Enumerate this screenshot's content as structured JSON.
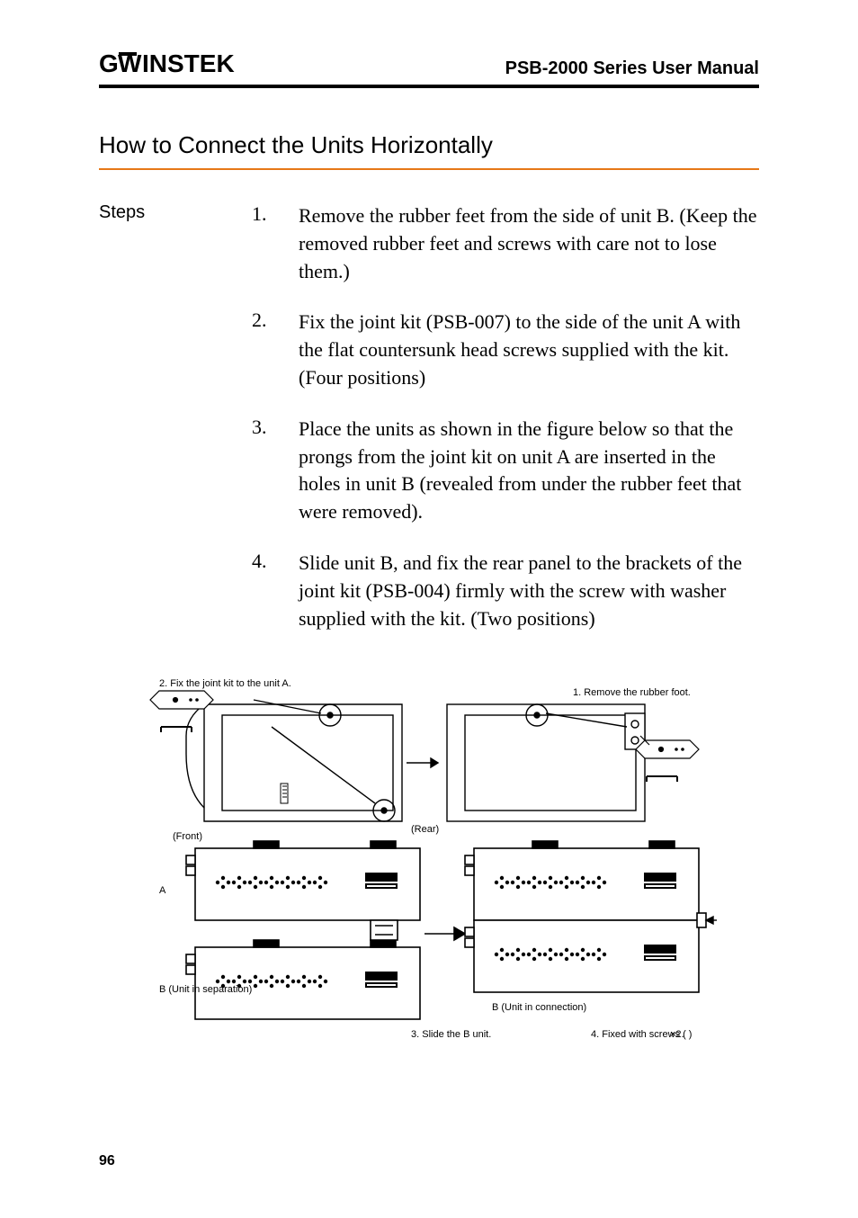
{
  "header": {
    "logo_text": "GW INSTEK",
    "manual_title": "PSB-2000 Series User Manual"
  },
  "section_title": "How to Connect the Units Horizontally",
  "steps_label": "Steps",
  "steps": [
    {
      "num": "1.",
      "text": "Remove the rubber feet from the side of unit B. (Keep the removed rubber feet and screws with care not to lose them.)"
    },
    {
      "num": "2.",
      "text": "Fix the joint kit (PSB-007) to the side of the unit A with the flat countersunk head screws supplied with the kit. (Four positions)"
    },
    {
      "num": "3.",
      "text": "Place the units as shown in the figure below so that the prongs from the joint kit on unit A are inserted in the holes in unit B (revealed from under the rubber feet that were removed)."
    },
    {
      "num": "4.",
      "text": "Slide unit B, and fix the rear panel to the brackets of the joint kit (PSB-004) firmly with the screw with washer supplied with the kit. (Two positions)"
    }
  ],
  "figure_labels": {
    "step1": "1. Remove the rubber foot.",
    "step2": "2. Fix the joint kit to the unit A.",
    "step3": "3. Slide the B unit.",
    "step4": "4. Fixed with screws (    )",
    "unitA": "A",
    "unitB_sep": "B (Unit in separation)",
    "unitB_con": "B (Unit in connection)",
    "front": "(Front)",
    "rear": "(Rear)",
    "times2": "×2."
  },
  "page_number": "96"
}
